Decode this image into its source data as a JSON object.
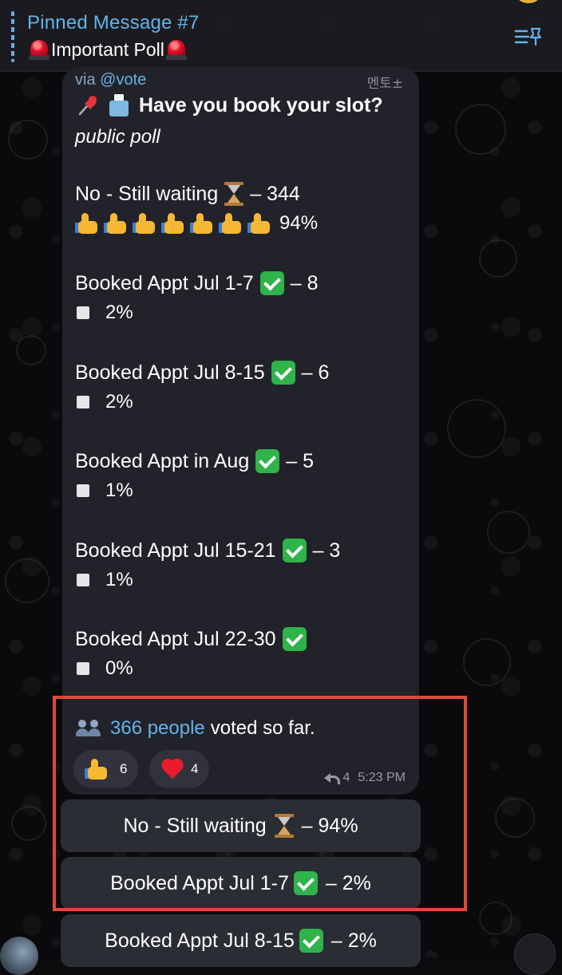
{
  "pinned": {
    "title": "Pinned Message #7",
    "subtitle": "Important Poll"
  },
  "message": {
    "via_prefix": "via",
    "bot": "@vote",
    "corner_text": "멘토±",
    "title": "Have you book your slot?",
    "poll_type": "public poll",
    "options": [
      {
        "label": "No - Still waiting",
        "count": "– 344",
        "percent": "94%",
        "thumbs": 7
      },
      {
        "label": "Booked Appt Jul 1-7",
        "count": "– 8",
        "percent": "2%"
      },
      {
        "label": "Booked Appt Jul 8-15",
        "count": "– 6",
        "percent": "2%"
      },
      {
        "label": "Booked Appt in Aug",
        "count": "– 5",
        "percent": "1%"
      },
      {
        "label": "Booked Appt Jul 15-21",
        "count": "– 3",
        "percent": "1%"
      },
      {
        "label": "Booked Appt Jul 22-30",
        "count": "",
        "percent": "0%"
      }
    ],
    "voters_count": "366 people",
    "voters_text": "voted so far.",
    "reactions": [
      {
        "emoji": "thumbs-up",
        "count": "6"
      },
      {
        "emoji": "red-heart",
        "count": "4"
      }
    ],
    "forwards": "4",
    "time": "5:23 PM"
  },
  "keyboard": [
    {
      "label": "No - Still waiting",
      "suffix": "– 94%"
    },
    {
      "label": "Booked Appt Jul 1-7",
      "suffix": "– 2%"
    },
    {
      "label": "Booked Appt Jul 8-15",
      "suffix": "– 2%"
    }
  ],
  "colors": {
    "link": "#63b4e8",
    "bubble": "#22222a",
    "highlight": "#e0483e",
    "check": "#2fb34a"
  }
}
